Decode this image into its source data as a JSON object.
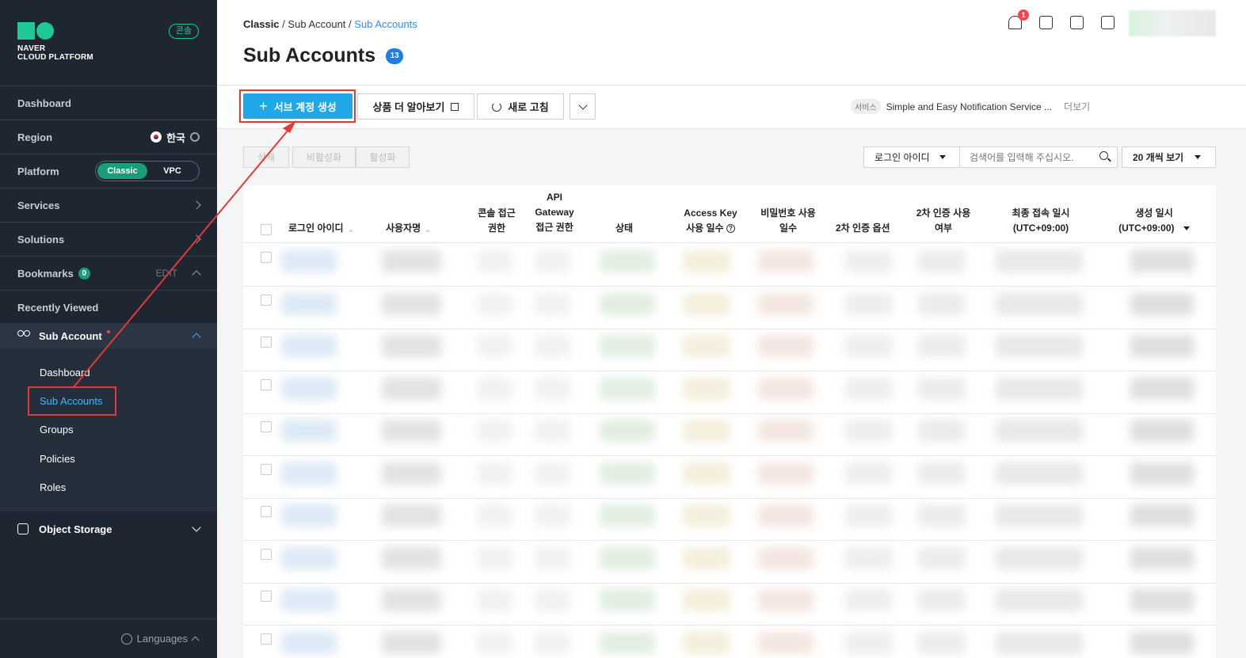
{
  "brand": {
    "line1": "NAVER",
    "line2": "CLOUD PLATFORM",
    "console_badge": "콘솔"
  },
  "sidebar": {
    "dashboard": "Dashboard",
    "region": {
      "label": "Region",
      "value": "한국"
    },
    "platform": {
      "label": "Platform",
      "options": [
        "Classic",
        "VPC"
      ],
      "selected": "Classic"
    },
    "services": "Services",
    "solutions": "Solutions",
    "bookmarks": {
      "label": "Bookmarks",
      "count": "0",
      "edit": "EDIT"
    },
    "recently_viewed": "Recently Viewed",
    "sub_account": {
      "label": "Sub Account",
      "items": [
        "Dashboard",
        "Sub Accounts",
        "Groups",
        "Policies",
        "Roles"
      ],
      "active": "Sub Accounts"
    },
    "object_storage": "Object Storage",
    "languages": "Languages"
  },
  "breadcrumb": {
    "root": "Classic",
    "parent": "Sub Account",
    "current": "Sub Accounts",
    "sep": "/"
  },
  "page": {
    "title": "Sub Accounts",
    "count": "13"
  },
  "header": {
    "notification_count": "1"
  },
  "toolbar": {
    "create_label": "서브 계정 생성",
    "learn_more_label": "상품 더 알아보기",
    "refresh_label": "새로 고침",
    "service_tag": "서비스",
    "service_text": "Simple and Easy Notification Service ...",
    "more_label": "더보기"
  },
  "actions": {
    "delete": "삭제",
    "deactivate": "비활성화",
    "activate": "활성화"
  },
  "filter": {
    "field": "로그인 아이디",
    "placeholder": "검색어를 입력해 주십시오.",
    "page_size": "20 개씩 보기"
  },
  "table": {
    "headers": {
      "login_id": "로그인 아이디",
      "username": "사용자명",
      "console_access": [
        "콘솔 접근",
        "권한"
      ],
      "api_access": [
        "API",
        "Gateway",
        "접근 권한"
      ],
      "status": "상태",
      "access_key": [
        "Access Key",
        "사용 일수"
      ],
      "pw_days": [
        "비밀번호 사용",
        "일수"
      ],
      "mfa_option": "2차 인증 옵션",
      "mfa_use": [
        "2차 인증 사용",
        "여부"
      ],
      "last_login": [
        "최종 접속 일시",
        "(UTC+09:00)"
      ],
      "created": [
        "생성 일시",
        "(UTC+09:00)"
      ]
    }
  },
  "colors": {
    "accent": "#1fa7e8",
    "sidebar": "#1e2632",
    "brand_green": "#1ec997",
    "annotation": "#e53935"
  }
}
